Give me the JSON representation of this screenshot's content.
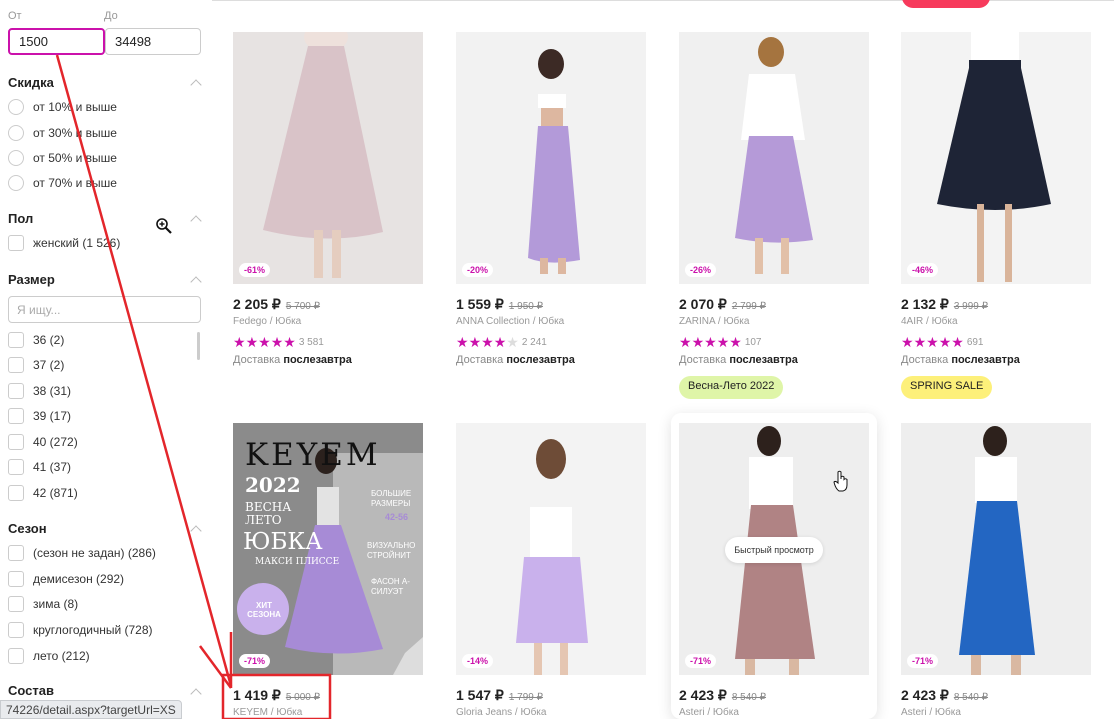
{
  "filters": {
    "price": {
      "from_label": "От",
      "to_label": "До",
      "from_value": "1500",
      "to_value": "34498"
    },
    "discount": {
      "title": "Скидка",
      "options": [
        "от 10% и выше",
        "от 30% и выше",
        "от 50% и выше",
        "от 70% и выше"
      ]
    },
    "gender": {
      "title": "Пол",
      "options": [
        "женский (1 526)"
      ]
    },
    "size": {
      "title": "Размер",
      "search_placeholder": "Я ищу...",
      "options": [
        "36 (2)",
        "37 (2)",
        "38 (31)",
        "39 (17)",
        "40 (272)",
        "41 (37)",
        "42 (871)"
      ]
    },
    "season": {
      "title": "Сезон",
      "options": [
        "(сезон не задан) (286)",
        "демисезон (292)",
        "зима (8)",
        "круглогодичный (728)",
        "лето (212)"
      ]
    },
    "composition": {
      "title": "Состав"
    }
  },
  "status_url": "74226/detail.aspx?targetUrl=XS",
  "products": [
    {
      "discount": "-61%",
      "price": "2 205 ₽",
      "old_price": "5 700 ₽",
      "brand": "Fedego / Юбка",
      "stars": 5,
      "reviews": "3 581",
      "delivery_prefix": "Доставка",
      "delivery_day": "послезавтра",
      "badge": "",
      "image_colors": [
        "#e7e3e2",
        "#d9c3c8"
      ]
    },
    {
      "discount": "-20%",
      "price": "1 559 ₽",
      "old_price": "1 950 ₽",
      "brand": "ANNA Collection / Юбка",
      "stars": 4,
      "reviews": "2 241",
      "delivery_prefix": "Доставка",
      "delivery_day": "послезавтра",
      "badge": "",
      "image_colors": [
        "#f2f2f2",
        "#b39ad9"
      ]
    },
    {
      "discount": "-26%",
      "price": "2 070 ₽",
      "old_price": "2 799 ₽",
      "brand": "ZARINA / Юбка",
      "stars": 5,
      "reviews": "107",
      "delivery_prefix": "Доставка",
      "delivery_day": "послезавтра",
      "badge": "Весна-Лето 2022",
      "badge_color": "#dff5a8",
      "image_colors": [
        "#f0f0f0",
        "#b59ad8"
      ]
    },
    {
      "discount": "-46%",
      "price": "2 132 ₽",
      "old_price": "3 999 ₽",
      "brand": "4AIR / Юбка",
      "stars": 5,
      "reviews": "691",
      "delivery_prefix": "Доставка",
      "delivery_day": "послезавтра",
      "badge": "SPRING SALE",
      "badge_color": "#fdf07a",
      "image_colors": [
        "#f3f3f3",
        "#1e2436"
      ]
    },
    {
      "discount": "-71%",
      "price": "1 419 ₽",
      "old_price": "5 000 ₽",
      "brand": "KEYEM / Юбка",
      "image_colors": [
        "#8b8b8b",
        "#a78bd6"
      ],
      "poster": {
        "brand": "KEYEM",
        "year": "2022",
        "season": "ВЕСНА ЛЕТО",
        "title": "ЮБКА",
        "subtitle": "МАКСИ ПЛИССЕ",
        "sizes_label": "БОЛЬШИЕ РАЗМЕРЫ",
        "sizes": "42-56",
        "slim": "ВИЗУАЛЬНО СТРОЙНИТ",
        "fit": "ФАСОН А-СИЛУЭТ",
        "hit": "ХИТ СЕЗОНА"
      }
    },
    {
      "discount": "-14%",
      "price": "1 547 ₽",
      "old_price": "1 799 ₽",
      "brand": "Gloria Jeans / Юбка",
      "image_colors": [
        "#f3f3f3",
        "#c9b1ec"
      ]
    },
    {
      "discount": "-71%",
      "price": "2 423 ₽",
      "old_price": "8 540 ₽",
      "brand": "Asteri / Юбка",
      "quick_view": "Быстрый просмотр",
      "image_colors": [
        "#eeeeee",
        "#b08384"
      ]
    },
    {
      "discount": "-71%",
      "price": "2 423 ₽",
      "old_price": "8 540 ₽",
      "brand": "Asteri / Юбка",
      "image_colors": [
        "#eeeeee",
        "#2366c2"
      ]
    }
  ],
  "annotation_color": "#e3262b",
  "accent_color": "#cb11ab"
}
